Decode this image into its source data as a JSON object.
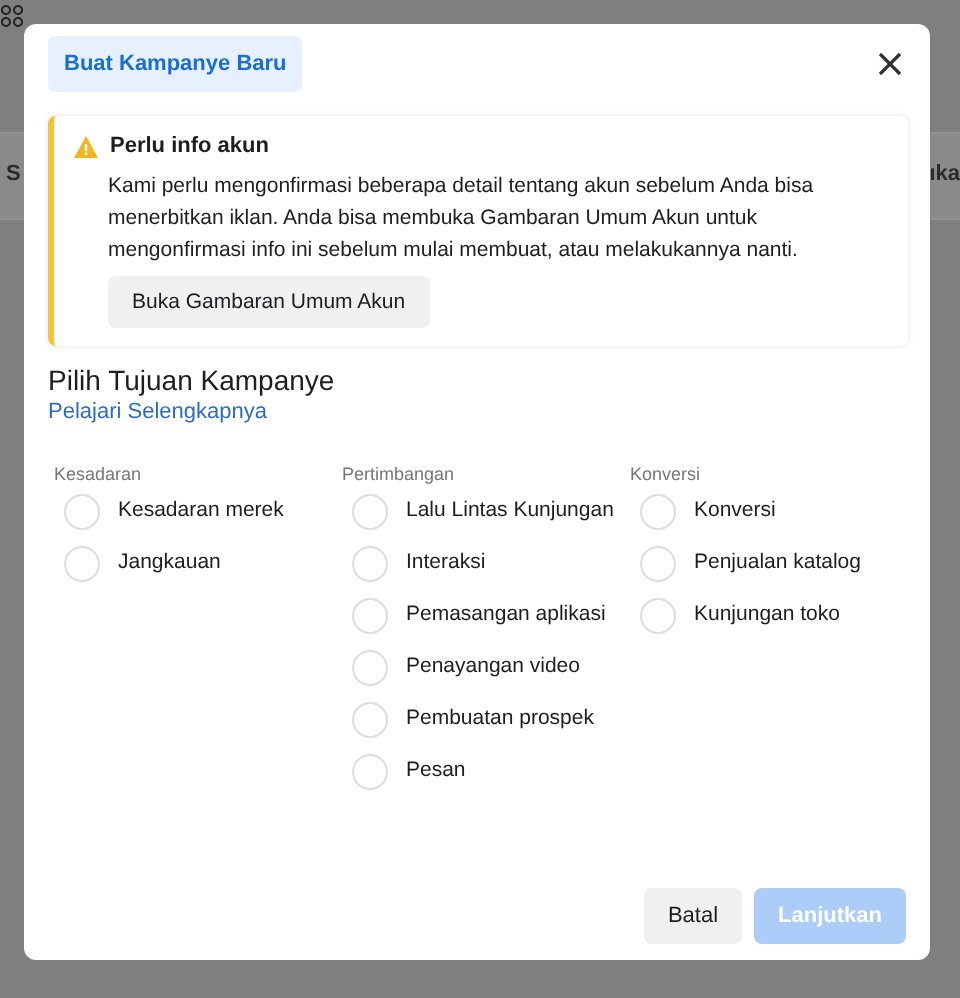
{
  "background": {
    "texts": [
      "S",
      "ıka"
    ]
  },
  "dialog": {
    "title": "Buat Kampanye Baru",
    "alert": {
      "title": "Perlu info akun",
      "body": "Kami perlu mengonfirmasi beberapa detail tentang akun sebelum Anda bisa menerbitkan iklan. Anda bisa membuka Gambaran Umum Akun untuk mengonfirmasi info ini sebelum mulai membuat, atau melakukannya nanti.",
      "button": "Buka Gambaran Umum Akun"
    },
    "heading": "Pilih Tujuan Kampanye",
    "link": "Pelajari Selengkapnya",
    "groups": [
      {
        "label": "Kesadaran",
        "options": [
          {
            "label": "Kesadaran merek",
            "selected": false
          },
          {
            "label": "Jangkauan",
            "selected": false
          }
        ]
      },
      {
        "label": "Pertimbangan",
        "options": [
          {
            "label": "Lalu Lintas Kunjungan",
            "selected": false
          },
          {
            "label": "Interaksi",
            "selected": false
          },
          {
            "label": "Pemasangan aplikasi",
            "selected": false
          },
          {
            "label": "Penayangan video",
            "selected": false
          },
          {
            "label": "Pembuatan prospek",
            "selected": false
          },
          {
            "label": "Pesan",
            "selected": false
          }
        ]
      },
      {
        "label": "Konversi",
        "options": [
          {
            "label": "Konversi",
            "selected": false
          },
          {
            "label": "Penjualan katalog",
            "selected": false
          },
          {
            "label": "Kunjungan toko",
            "selected": false
          }
        ]
      }
    ],
    "buttons": [
      {
        "label": "Batal",
        "kind": "secondary"
      },
      {
        "label": "Lanjutkan",
        "kind": "primary",
        "disabled": true
      }
    ]
  }
}
